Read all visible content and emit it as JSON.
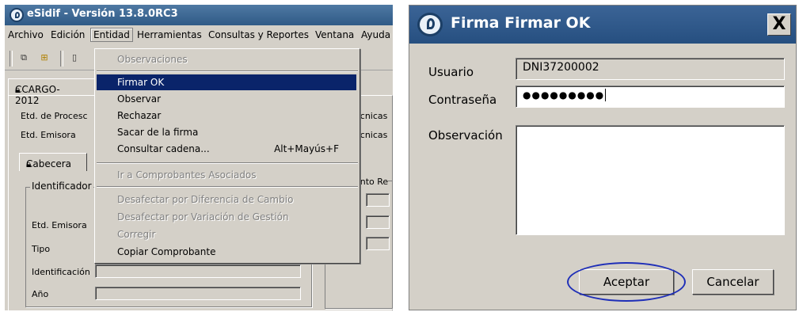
{
  "left_window": {
    "title": "eSidif - Versión 13.8.0RC3",
    "menu": [
      "Archivo",
      "Edición",
      "Entidad",
      "Herramientas",
      "Consultas y Reportes",
      "Ventana",
      "Ayuda"
    ],
    "doc_tab": "CCARGO-2012",
    "labels": {
      "etd_proceso": "Etd. de Procesc",
      "etd_emisora": "Etd. Emisora",
      "cabecera_tab": "Cabecera",
      "identificador": "Identificador",
      "etd_emisora2": "Etd. Emisora",
      "tipo": "Tipo",
      "identificacion": "Identificación",
      "anio": "Año",
      "tecnicas1": "écnicas",
      "tecnicas2": "écnicas",
      "cento": "ento Re",
      "o1": "o",
      "o2": "o"
    },
    "dropdown": [
      {
        "label": "Observaciones",
        "enabled": false
      },
      {
        "label": "Firmar OK",
        "enabled": true,
        "selected": true
      },
      {
        "label": "Observar",
        "enabled": true
      },
      {
        "label": "Rechazar",
        "enabled": true
      },
      {
        "label": "Sacar de la firma",
        "enabled": true
      },
      {
        "label": "Consultar cadena...",
        "shortcut": "Alt+Mayús+F",
        "enabled": true
      },
      {
        "label": "Ir a Comprobantes Asociados",
        "enabled": false
      },
      {
        "label": "Desafectar por Diferencia de Cambio",
        "enabled": false
      },
      {
        "label": "Desafectar por Variación de Gestión",
        "enabled": false
      },
      {
        "label": "Corregir",
        "enabled": false
      },
      {
        "label": "Copiar Comprobante",
        "enabled": true
      }
    ]
  },
  "dialog": {
    "title": "Firma Firmar OK",
    "close": "X",
    "usuario_label": "Usuario",
    "usuario_value": "DNI37200002",
    "password_label": "Contraseña",
    "password_value": "●●●●●●●●●",
    "observacion_label": "Observación",
    "accept": "Aceptar",
    "cancel": "Cancelar",
    "highlight_color": "#1f2fb8"
  }
}
